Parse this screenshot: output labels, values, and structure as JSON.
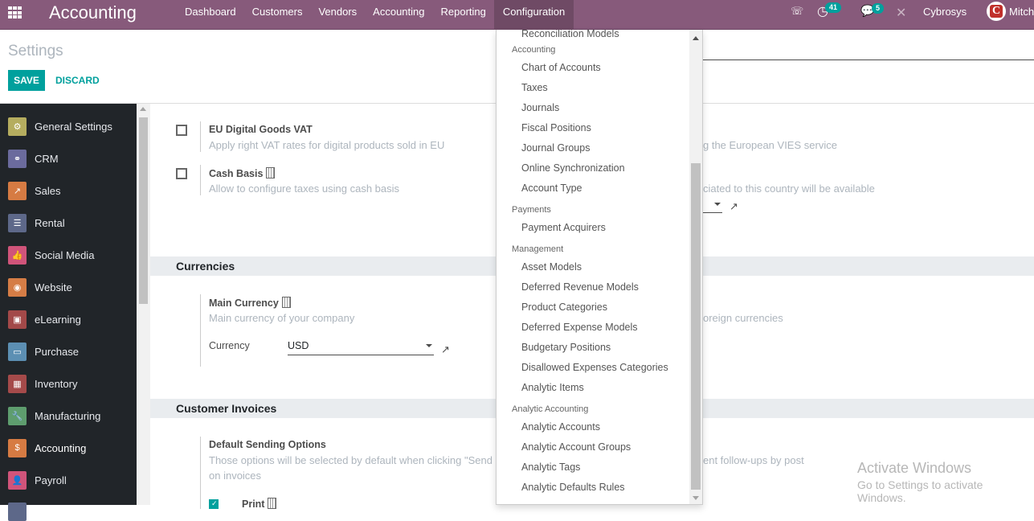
{
  "navbar": {
    "app_title": "Accounting",
    "menu": [
      {
        "label": "Dashboard"
      },
      {
        "label": "Customers"
      },
      {
        "label": "Vendors"
      },
      {
        "label": "Accounting"
      },
      {
        "label": "Reporting"
      },
      {
        "label": "Configuration",
        "active": true
      }
    ],
    "systray": {
      "phone_icon": "☏",
      "activity_icon": "◷",
      "activity_count": "41",
      "chat_icon": "💬",
      "chat_count": "5",
      "debug_icon": "✕",
      "company": "Cybrosys",
      "avatar_letter": "C",
      "user": "Mitch"
    }
  },
  "control_panel": {
    "breadcrumb": "Settings",
    "save_label": "SAVE",
    "discard_label": "DISCARD"
  },
  "sidebar": {
    "items": [
      {
        "label": "General Settings",
        "icon": "gear-icon",
        "glyph": "⚙",
        "color": "#b5ad5f"
      },
      {
        "label": "CRM",
        "icon": "handshake-icon",
        "glyph": "⚭",
        "color": "#6b6b9d"
      },
      {
        "label": "Sales",
        "icon": "chart-trend-icon",
        "glyph": "↗",
        "color": "#d67b43"
      },
      {
        "label": "Rental",
        "icon": "rental-icon",
        "glyph": "☰",
        "color": "#5d6889"
      },
      {
        "label": "Social Media",
        "icon": "thumbs-up-icon",
        "glyph": "👍",
        "color": "#d0547a"
      },
      {
        "label": "Website",
        "icon": "globe-icon",
        "glyph": "◉",
        "color": "#d57d46"
      },
      {
        "label": "eLearning",
        "icon": "elearning-icon",
        "glyph": "▣",
        "color": "#a34949"
      },
      {
        "label": "Purchase",
        "icon": "credit-card-icon",
        "glyph": "▭",
        "color": "#5c8fb3"
      },
      {
        "label": "Inventory",
        "icon": "box-icon",
        "glyph": "▦",
        "color": "#a54a4a"
      },
      {
        "label": "Manufacturing",
        "icon": "wrench-icon",
        "glyph": "🔧",
        "color": "#5e9d6e"
      },
      {
        "label": "Accounting",
        "icon": "invoice-dollar-icon",
        "glyph": "$",
        "color": "#d67b43",
        "active": true
      },
      {
        "label": "Payroll",
        "icon": "payroll-icon",
        "glyph": "👤",
        "color": "#d0547a"
      }
    ]
  },
  "content": {
    "eu_vat": {
      "title": "EU Digital Goods VAT",
      "desc": "Apply right VAT rates for digital products sold in EU",
      "checked": false
    },
    "cash_basis": {
      "title": "Cash Basis",
      "desc": "Allow to configure taxes using cash basis",
      "checked": false
    },
    "right_desc_1": "g the European VIES service",
    "right_desc_2": "ciated to this country will be available",
    "currencies_section": "Currencies",
    "main_currency": {
      "title": "Main Currency",
      "desc": "Main currency of your company",
      "field_label": "Currency",
      "value": "USD"
    },
    "right_desc_3": "oreign currencies",
    "customer_invoices_section": "Customer Invoices",
    "sending_options": {
      "title": "Default Sending Options",
      "desc_line1": "Those options will be selected by default when clicking \"Send",
      "desc_line2": "on invoices",
      "print_label": "Print",
      "print_checked": true
    },
    "right_desc_4": "ent follow-ups by post"
  },
  "config_dropdown": {
    "entries": [
      {
        "type": "item",
        "label": "Reconciliation Models"
      },
      {
        "type": "header",
        "label": "Accounting"
      },
      {
        "type": "item",
        "label": "Chart of Accounts"
      },
      {
        "type": "item",
        "label": "Taxes"
      },
      {
        "type": "item",
        "label": "Journals"
      },
      {
        "type": "item",
        "label": "Fiscal Positions"
      },
      {
        "type": "item",
        "label": "Journal Groups"
      },
      {
        "type": "item",
        "label": "Online Synchronization"
      },
      {
        "type": "item",
        "label": "Account Type"
      },
      {
        "type": "header",
        "label": "Payments"
      },
      {
        "type": "item",
        "label": "Payment Acquirers"
      },
      {
        "type": "header",
        "label": "Management"
      },
      {
        "type": "item",
        "label": "Asset Models"
      },
      {
        "type": "item",
        "label": "Deferred Revenue Models"
      },
      {
        "type": "item",
        "label": "Product Categories"
      },
      {
        "type": "item",
        "label": "Deferred Expense Models"
      },
      {
        "type": "item",
        "label": "Budgetary Positions"
      },
      {
        "type": "item",
        "label": "Disallowed Expenses Categories"
      },
      {
        "type": "item",
        "label": "Analytic Items"
      },
      {
        "type": "header",
        "label": "Analytic Accounting"
      },
      {
        "type": "item",
        "label": "Analytic Accounts"
      },
      {
        "type": "item",
        "label": "Analytic Account Groups"
      },
      {
        "type": "item",
        "label": "Analytic Tags"
      },
      {
        "type": "item",
        "label": "Analytic Defaults Rules"
      }
    ]
  },
  "watermark": {
    "line1": "Activate Windows",
    "line2": "Go to Settings to activate Windows."
  }
}
